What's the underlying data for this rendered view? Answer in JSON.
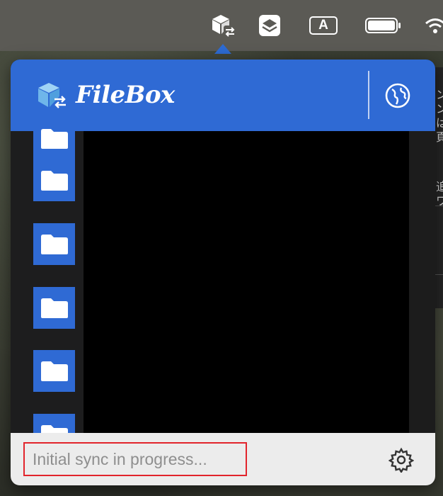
{
  "menubar": {
    "items": [
      {
        "name": "filebox-menubar-icon"
      },
      {
        "name": "layers-icon"
      },
      {
        "name": "input-source",
        "label": "A"
      },
      {
        "name": "battery-icon"
      },
      {
        "name": "wifi-icon"
      }
    ]
  },
  "background_window": {
    "lines": [
      "ン",
      "ン",
      "は",
      "頁",
      "追",
      "ワ"
    ]
  },
  "popover": {
    "app_name": "FileBox",
    "globe_icon": "globe-icon",
    "folders_icon": "folder-icon",
    "status_text": "Initial sync in progress...",
    "settings_icon": "gear-icon",
    "colors": {
      "header": "#2f6ad4",
      "folder_tile": "#2f6ad4",
      "footer": "#ececec",
      "highlight": "#e2242c"
    }
  }
}
